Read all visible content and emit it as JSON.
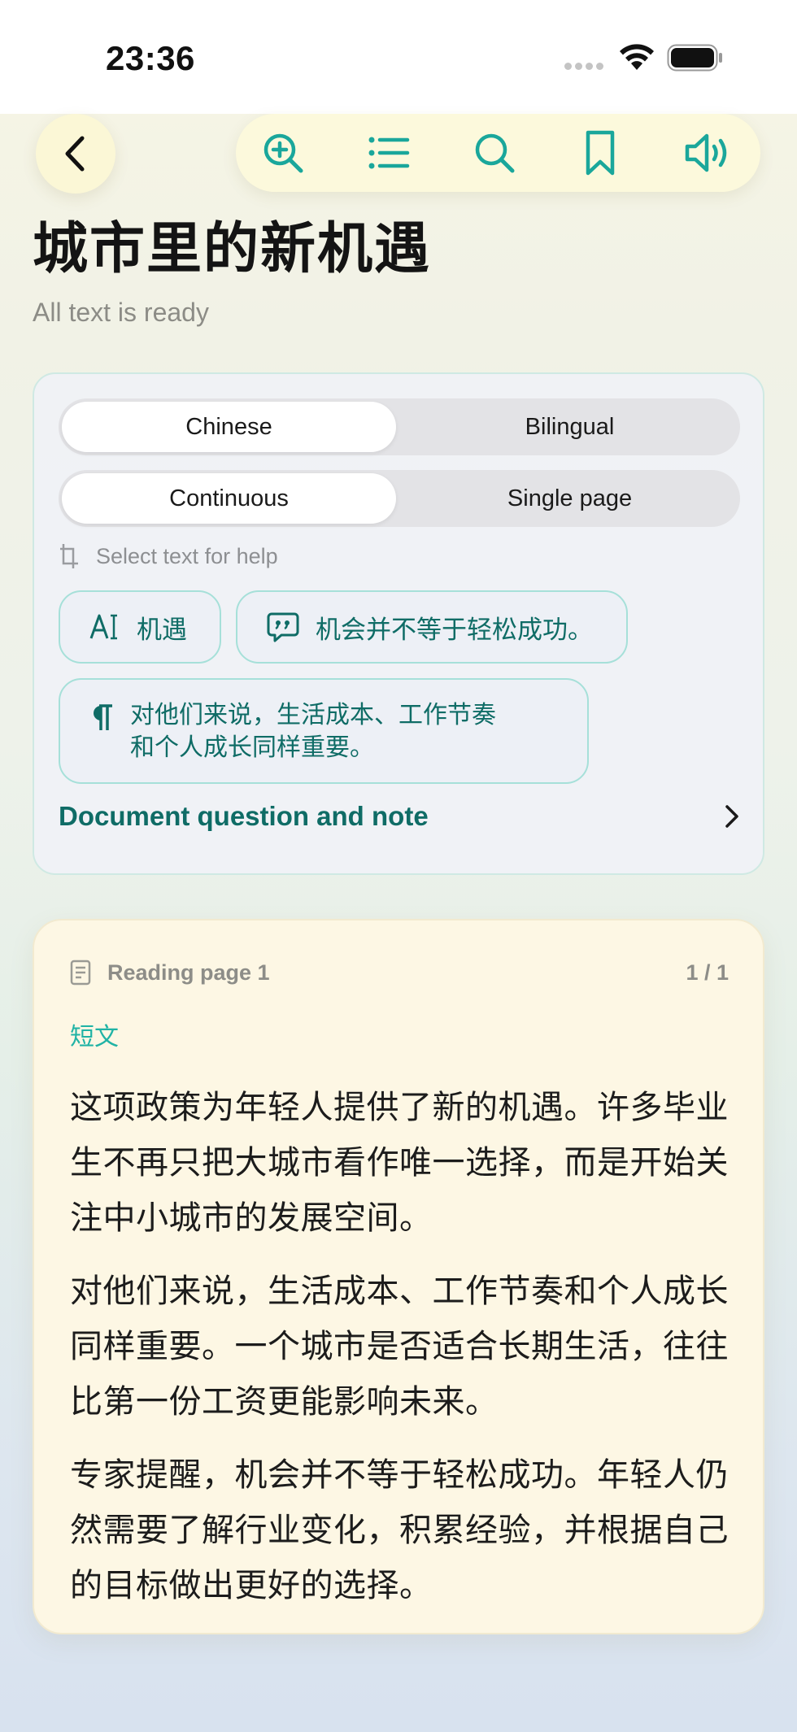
{
  "status_bar": {
    "time": "23:36"
  },
  "toolbar": {
    "icons": [
      "zoom-in-icon",
      "list-icon",
      "search-icon",
      "bookmark-icon",
      "speaker-icon"
    ]
  },
  "header": {
    "title": "城市里的新机遇",
    "subtitle": "All text is ready"
  },
  "options": {
    "language_mode": {
      "options": [
        "Chinese",
        "Bilingual"
      ],
      "selected": "Chinese"
    },
    "layout_mode": {
      "options": [
        "Continuous",
        "Single page"
      ],
      "selected": "Continuous"
    },
    "hint": "Select text for help",
    "chips": {
      "word": "机遇",
      "sentence": "机会并不等于轻松成功。",
      "paragraph_line1": "对他们来说，生活成本、工作节奏",
      "paragraph_line2": "和个人成长同样重要。"
    },
    "document_link": "Document question and note"
  },
  "reading": {
    "page_label": "Reading page 1",
    "page_count": "1 / 1",
    "section": "短文",
    "paragraphs": [
      "这项政策为年轻人提供了新的机遇。许多毕业生不再只把大城市看作唯一选择，而是开始关注中小城市的发展空间。",
      "对他们来说，生活成本、工作节奏和个人成长同样重要。一个城市是否适合长期生活，往往比第一份工资更能影响未来。",
      "专家提醒，机会并不等于轻松成功。年轻人仍然需要了解行业变化，积累经验，并根据自己的目标做出更好的选择。"
    ]
  },
  "colors": {
    "accent": "#1aa79b",
    "accent_dark": "#0f6c66",
    "reading_bg": "#fdf7e4"
  }
}
